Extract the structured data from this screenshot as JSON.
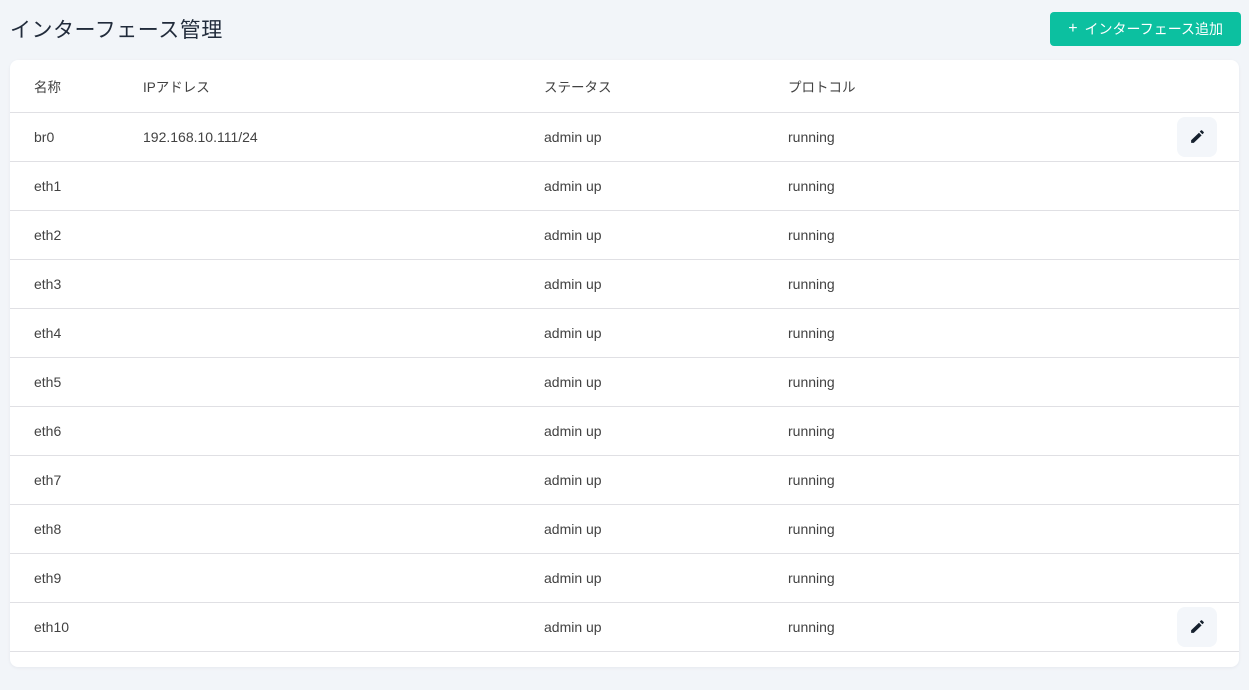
{
  "page": {
    "title": "インターフェース管理"
  },
  "add_button": {
    "icon": "+",
    "label": "インターフェース追加"
  },
  "table": {
    "columns": [
      "名称",
      "IPアドレス",
      "ステータス",
      "プロトコル"
    ],
    "rows": [
      {
        "name": "br0",
        "ip": "192.168.10.111/24",
        "status": "admin up",
        "protocol": "running",
        "editable": true
      },
      {
        "name": "eth1",
        "ip": "",
        "status": "admin up",
        "protocol": "running",
        "editable": false
      },
      {
        "name": "eth2",
        "ip": "",
        "status": "admin up",
        "protocol": "running",
        "editable": false
      },
      {
        "name": "eth3",
        "ip": "",
        "status": "admin up",
        "protocol": "running",
        "editable": false
      },
      {
        "name": "eth4",
        "ip": "",
        "status": "admin up",
        "protocol": "running",
        "editable": false
      },
      {
        "name": "eth5",
        "ip": "",
        "status": "admin up",
        "protocol": "running",
        "editable": false
      },
      {
        "name": "eth6",
        "ip": "",
        "status": "admin up",
        "protocol": "running",
        "editable": false
      },
      {
        "name": "eth7",
        "ip": "",
        "status": "admin up",
        "protocol": "running",
        "editable": false
      },
      {
        "name": "eth8",
        "ip": "",
        "status": "admin up",
        "protocol": "running",
        "editable": false
      },
      {
        "name": "eth9",
        "ip": "",
        "status": "admin up",
        "protocol": "running",
        "editable": false
      },
      {
        "name": "eth10",
        "ip": "",
        "status": "admin up",
        "protocol": "running",
        "editable": true
      }
    ]
  },
  "colors": {
    "accent": "#0cc0a0",
    "page_bg": "#f2f5f9",
    "card_bg": "#ffffff",
    "text": "#424242",
    "title": "#212b3b",
    "border": "#e0e0e4",
    "edit_button_bg": "#f3f6fa",
    "pencil": "#16212e"
  }
}
